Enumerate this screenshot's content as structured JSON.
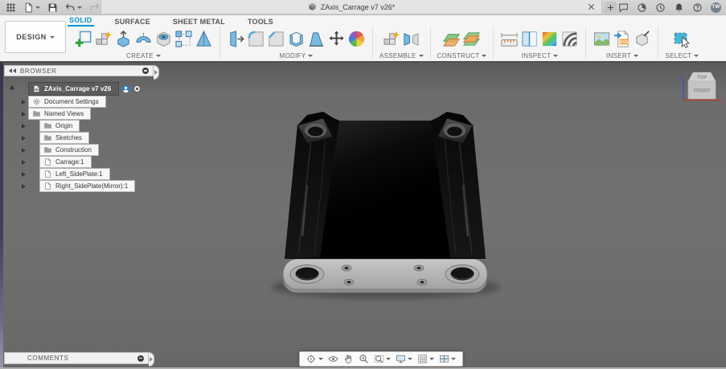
{
  "topbar": {
    "tab": {
      "title": "ZAxis_Carrage v7 v26*"
    },
    "avatar": "TW"
  },
  "ribbon": {
    "design_label": "DESIGN",
    "tabs": [
      {
        "label": "SOLID",
        "active": true
      },
      {
        "label": "SURFACE",
        "active": false
      },
      {
        "label": "SHEET METAL",
        "active": false
      },
      {
        "label": "TOOLS",
        "active": false
      }
    ],
    "groups": [
      {
        "label": "CREATE",
        "icons": [
          "create-sketch",
          "create-form",
          "extrude",
          "revolve",
          "hole",
          "pattern",
          "loft"
        ]
      },
      {
        "label": "MODIFY",
        "icons": [
          "press-pull",
          "fillet",
          "chamfer",
          "shell",
          "draft",
          "move",
          "appearance"
        ]
      },
      {
        "label": "ASSEMBLE",
        "icons": [
          "new-component",
          "joint"
        ]
      },
      {
        "label": "CONSTRUCT",
        "icons": [
          "offset-plane",
          "midplane"
        ]
      },
      {
        "label": "INSPECT",
        "icons": [
          "measure",
          "section-analysis",
          "curvature",
          "zebra"
        ]
      },
      {
        "label": "INSERT",
        "icons": [
          "canvas",
          "insert-svg",
          "insert-mesh"
        ]
      },
      {
        "label": "SELECT",
        "icons": [
          "select"
        ]
      }
    ]
  },
  "browser": {
    "header": "BROWSER",
    "root": {
      "label": "ZAxis_Carrage v7 v26"
    },
    "items": [
      {
        "label": "Document Settings",
        "icon": "gear",
        "eye": "none"
      },
      {
        "label": "Named Views",
        "icon": "folder",
        "eye": "none"
      },
      {
        "label": "Origin",
        "icon": "folder",
        "eye": "off"
      },
      {
        "label": "Sketches",
        "icon": "folder",
        "eye": "on"
      },
      {
        "label": "Construction",
        "icon": "folder",
        "eye": "on"
      },
      {
        "label": "Carrage:1",
        "icon": "component",
        "eye": "on"
      },
      {
        "label": "Left_SidePlate:1",
        "icon": "component",
        "eye": "on"
      },
      {
        "label": "Right_SidePlate(Mirror):1",
        "icon": "component",
        "eye": "on"
      }
    ]
  },
  "comments": {
    "header": "COMMENTS"
  },
  "viewcube": {
    "top": "TOP",
    "front": "FRONT",
    "axis_z": "Z",
    "axis_x": "X"
  },
  "navbar": {
    "items": [
      {
        "icon": "orbit",
        "caret": true
      },
      {
        "icon": "look-at",
        "caret": false
      },
      {
        "icon": "pan",
        "caret": false
      },
      {
        "icon": "zoom",
        "caret": false
      },
      {
        "icon": "fit",
        "caret": true
      },
      {
        "icon": "display-settings",
        "caret": true
      },
      {
        "icon": "grid-settings",
        "caret": true
      },
      {
        "icon": "viewports",
        "caret": true
      }
    ]
  },
  "colors": {
    "accent_blue": "#0a96d7",
    "viewport_gray": "#6e6e6e",
    "selected_row": "#5c5c5c"
  }
}
